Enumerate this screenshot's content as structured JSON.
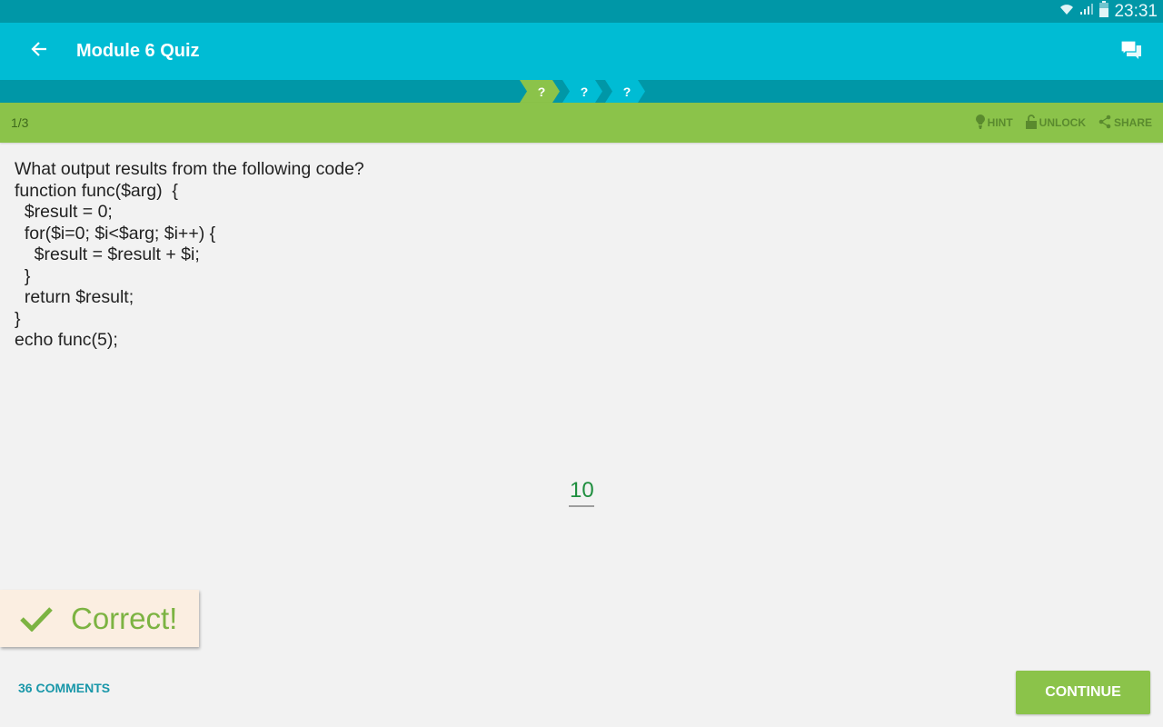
{
  "status_bar": {
    "time": "23:31",
    "icons": [
      "wifi-icon",
      "signal-icon",
      "battery-icon"
    ]
  },
  "app_bar": {
    "back_icon": "arrow-back-icon",
    "title": "Module 6 Quiz",
    "discuss_icon": "forum-icon"
  },
  "progress": {
    "steps": [
      {
        "label": "?",
        "state": "current"
      },
      {
        "label": "?",
        "state": "pending"
      },
      {
        "label": "?",
        "state": "pending"
      }
    ]
  },
  "info_bar": {
    "counter": "1/3",
    "actions": [
      {
        "label": "HINT",
        "icon": "lightbulb-icon"
      },
      {
        "label": "UNLOCK",
        "icon": "lock-icon"
      },
      {
        "label": "SHARE",
        "icon": "share-icon"
      }
    ]
  },
  "question": {
    "text": "What output results from the following code?\nfunction func($arg)  {\n  $result = 0;\n  for($i=0; $i<$arg; $i++) {\n    $result = $result + $i;\n  }\n  return $result;\n}\necho func(5);"
  },
  "answer": {
    "value": "10"
  },
  "result": {
    "label": "Correct!",
    "icon": "check-icon"
  },
  "footer": {
    "comments_label": "36 COMMENTS",
    "continue_label": "CONTINUE"
  },
  "colors": {
    "primary": "#00bcd4",
    "primary_dark": "#0097a7",
    "accent_green": "#8bc34a",
    "correct_text": "#7cb342",
    "answer_text": "#1e8e3e"
  }
}
